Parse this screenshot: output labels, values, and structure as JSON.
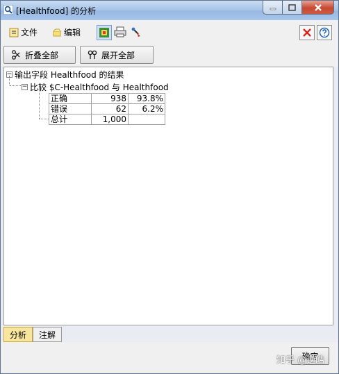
{
  "window": {
    "title": "[Healthfood] 的分析"
  },
  "menu": {
    "file": "文件",
    "edit": "编辑"
  },
  "actions": {
    "collapse_all": "折叠全部",
    "expand_all": "展开全部"
  },
  "tree": {
    "root": "输出字段 Healthfood 的结果",
    "comparison": "比较 $C-Healthfood 与 Healthfood",
    "rows": [
      {
        "label": "正确",
        "count": "938",
        "percent": "93.8%"
      },
      {
        "label": "错误",
        "count": "62",
        "percent": "6.2%"
      },
      {
        "label": "总计",
        "count": "1,000",
        "percent": ""
      }
    ]
  },
  "tabs": [
    {
      "label": "分析"
    },
    {
      "label": "注解"
    }
  ],
  "footer": {
    "ok": "确定",
    "watermark": "知乎 @逆皓"
  },
  "colors": {
    "active_tab": "#f7e69c",
    "close_icon": "#d7261b",
    "help_icon": "#1c5fb8"
  }
}
